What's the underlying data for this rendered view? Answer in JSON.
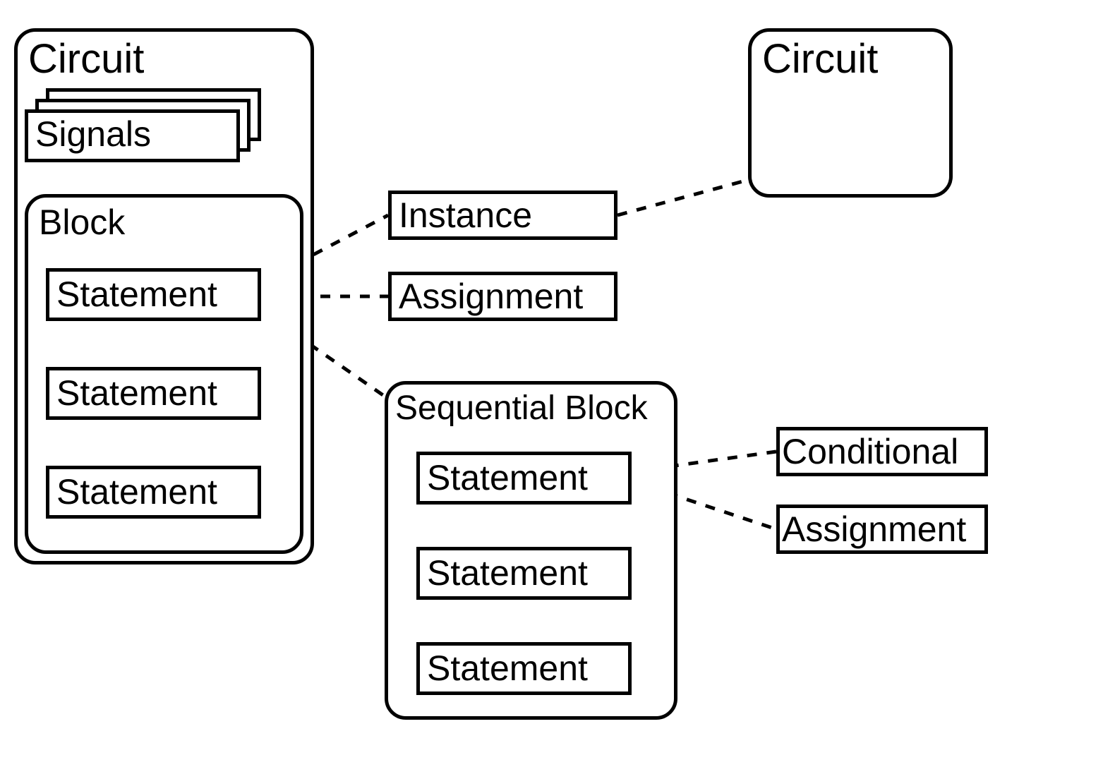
{
  "diagram": {
    "circuit_left": {
      "title": "Circuit",
      "signals_label": "Signals",
      "block": {
        "title": "Block",
        "statements": [
          "Statement",
          "Statement",
          "Statement"
        ]
      }
    },
    "circuit_right": {
      "title": "Circuit"
    },
    "stmt_kinds": {
      "instance": "Instance",
      "assignment": "Assignment"
    },
    "seq_block": {
      "title": "Sequential Block",
      "statements": [
        "Statement",
        "Statement",
        "Statement"
      ]
    },
    "seq_stmt_kinds": {
      "conditional": "Conditional",
      "assignment": "Assignment"
    }
  }
}
